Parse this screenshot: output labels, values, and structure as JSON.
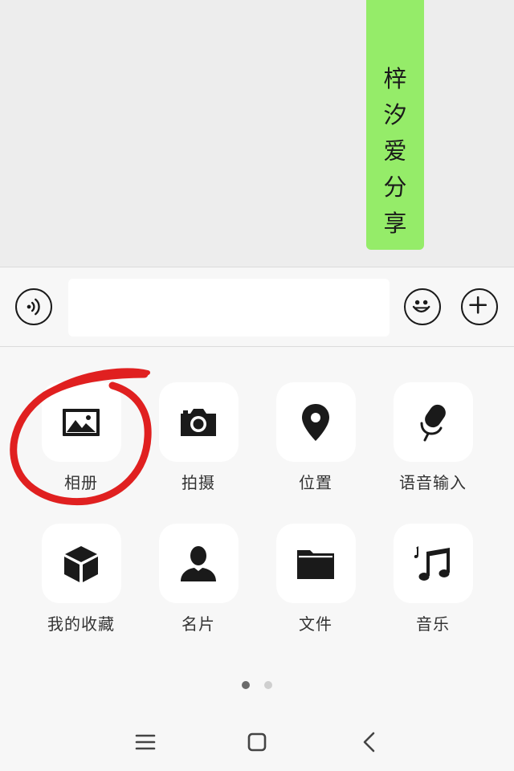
{
  "chat": {
    "message_chars": [
      "梓",
      "汐",
      "爱",
      "分",
      "享"
    ],
    "bubble_color": "#95ec69"
  },
  "input_bar": {
    "voice_icon": "voice-icon",
    "text_value": "",
    "emoji_icon": "emoji-icon",
    "plus_icon": "plus-icon"
  },
  "features": [
    {
      "label": "相册",
      "icon": "photo-album-icon"
    },
    {
      "label": "拍摄",
      "icon": "camera-icon"
    },
    {
      "label": "位置",
      "icon": "location-pin-icon"
    },
    {
      "label": "语音输入",
      "icon": "microphone-icon"
    },
    {
      "label": "我的收藏",
      "icon": "favorites-cube-icon"
    },
    {
      "label": "名片",
      "icon": "contact-card-icon"
    },
    {
      "label": "文件",
      "icon": "folder-icon"
    },
    {
      "label": "音乐",
      "icon": "music-note-icon"
    }
  ],
  "pager": {
    "pages": 2,
    "current": 1
  },
  "annotation_color": "#e02020",
  "nav": {
    "menu_icon": "menu-icon",
    "home_icon": "home-square-icon",
    "back_icon": "back-chevron-icon"
  }
}
